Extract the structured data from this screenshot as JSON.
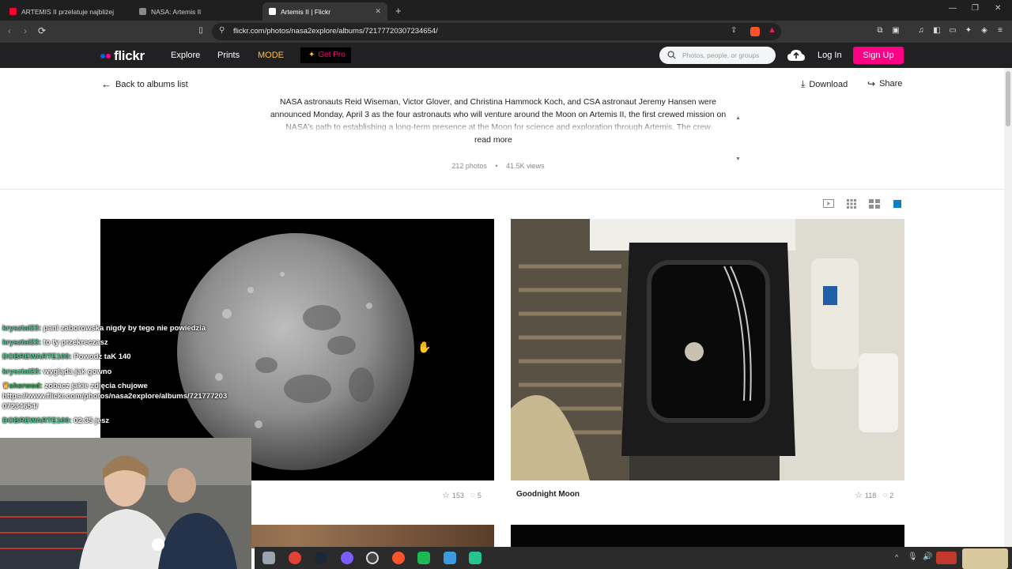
{
  "browser": {
    "tabs": [
      {
        "label": "ARTEMIS II przelatuje najbliżej K",
        "fav_color": "#ff0033"
      },
      {
        "label": "NASA: Artemis II",
        "fav_color": "#bbbbbb"
      },
      {
        "label": "Artemis II | Flickr",
        "fav_color": "#ffffff"
      }
    ],
    "url": "flickr.com/photos/nasa2explore/albums/72177720307234654/"
  },
  "header": {
    "logo": "flickr",
    "nav": [
      "Explore",
      "Prints",
      "MODE"
    ],
    "getpro": "Get Pro",
    "search_placeholder": "Photos, people, or groups",
    "login": "Log In",
    "signup": "Sign Up",
    "colors": {
      "brand_pink": "#ff0084",
      "brand_blue": "#0063dc",
      "mode_yellow": "#f5c344"
    }
  },
  "album": {
    "back": "Back to albums list",
    "download": "Download",
    "share": "Share",
    "description": "NASA astronauts Reid Wiseman, Victor Glover, and Christina Hammock Koch, and CSA astronaut Jeremy Hansen were announced Monday, April 3 as the four astronauts who will venture around the Moon on Artemis II, the first crewed mission on NASA’s path to establishing a long-term presence at the Moon for science and exploration through Artemis. The crew",
    "read_more": "read more",
    "photos": "212 photos",
    "views": "41.5K views"
  },
  "photos": [
    {
      "title": "",
      "faves": "153",
      "comments": "5"
    },
    {
      "title": "Goodnight Moon",
      "faves": "118",
      "comments": "2"
    }
  ],
  "chat": [
    {
      "name": "krysztal23:",
      "msg": "pani zaborowska nigdy by tego nie powiedzia"
    },
    {
      "name": "krysztal23:",
      "msg": "to ty przekreczasz"
    },
    {
      "name": "DOBREWARTE100:",
      "msg": "Powodz taK 140"
    },
    {
      "name": "krysztal23:",
      "msg": "wygląda jak gowno"
    },
    {
      "name": "sherwod:",
      "msg": "zobacz jakie zdjęcia chujowe https://www.flickr.com/photos/nasa2explore/albums/721777203 07234654/"
    },
    {
      "name": "DOBREWARTE100:",
      "msg": "02:35 jesz"
    }
  ]
}
